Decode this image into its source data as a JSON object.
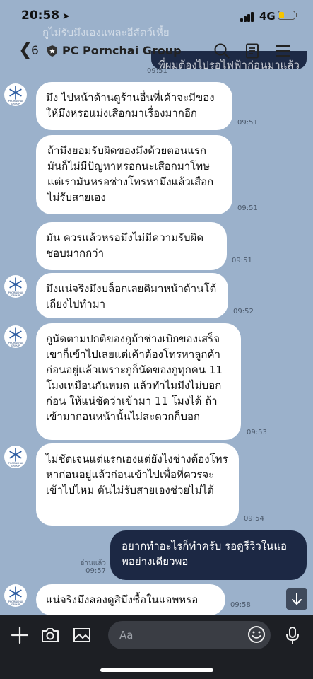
{
  "status_bar": {
    "time": "20:58",
    "network": "4G"
  },
  "pinned_notice": "กูไม่รับมึงเองแพละอีสัตว์เหี้ย",
  "header": {
    "back_count": "6",
    "title": "PC Pornchai Group"
  },
  "top_message": {
    "text": "พี่ผมต้องไปรอไฟฟ้าก่อนมาแล้ว",
    "time": "09:51"
  },
  "avatar_caption": "PHORNCHAI GROUP",
  "messages": [
    {
      "text": "มึง ไปหน้าด้านดูร้านอื่นที่เค้าจะมีของให้มึงหรอแม่งเสือกมาเรื่องมากอีก",
      "time": "09:51"
    },
    {
      "text": "ถ้ามึงยอมรับผิดของมึงด้วยตอนแรก มันก็ไม่มีปัญหาหรอกนะเสือกมาโทษแต่เรามันหรอช่างโทรหามึงแล้วเสือกไม่รับสายเอง",
      "time": "09:51"
    },
    {
      "text": "มัน ควรแล้วหรอมึงไม่มีความรับผิดชอบมากกว่า",
      "time": "09:51"
    },
    {
      "text": "มึงแน่จริงมึงบล็อกเลยดิมาหน้าด้านโต้เถียงไปทำมา",
      "time": "09:52"
    },
    {
      "text": "กูนัดตามปกติของกูถ้าช่างเบิกของเสร็จเขาก็เข้าไปเลยแต่เค้าต้องโทรหาลูกค้าก่อนอยู่แล้วเพราะกูก็นัดของกูทุกคน 11 โมงเหมือนกันหมด แล้วทำไมมึงไม่บอกก่อน ให้แน่ชัดว่าเข้ามา 11 โมงได้ ถ้าเข้ามาก่อนหน้านั้นไม่สะดวกก็บอก",
      "time": "09:53"
    },
    {
      "text": "ไม่ชัดเจนแต่แรกเองแต่ยังไงช่างต้องโทรหาก่อนอยู่แล้วก่อนเข้าไปเพื่อที่ควรจะเข้าไปไหม ดันไม่รับสายเองช่วยไม่ได้",
      "time": "09:54"
    },
    {
      "text": "อยากทำอะไรก็ทำครับ รอดูรีวิวในแอพอย่างเดียวพอ",
      "read": "อ่านแล้ว",
      "time": "09:57"
    },
    {
      "text": "แน่จริงมึงลองดูสิมึงซื้อในแอพหรอ",
      "time": "09:58"
    }
  ],
  "input": {
    "placeholder": "Aa"
  },
  "colors": {
    "background": "#9bb1cb",
    "outgoing_bubble": "#1c2844",
    "incoming_bubble": "#ffffff",
    "bottom_bar": "#1d1f24"
  }
}
